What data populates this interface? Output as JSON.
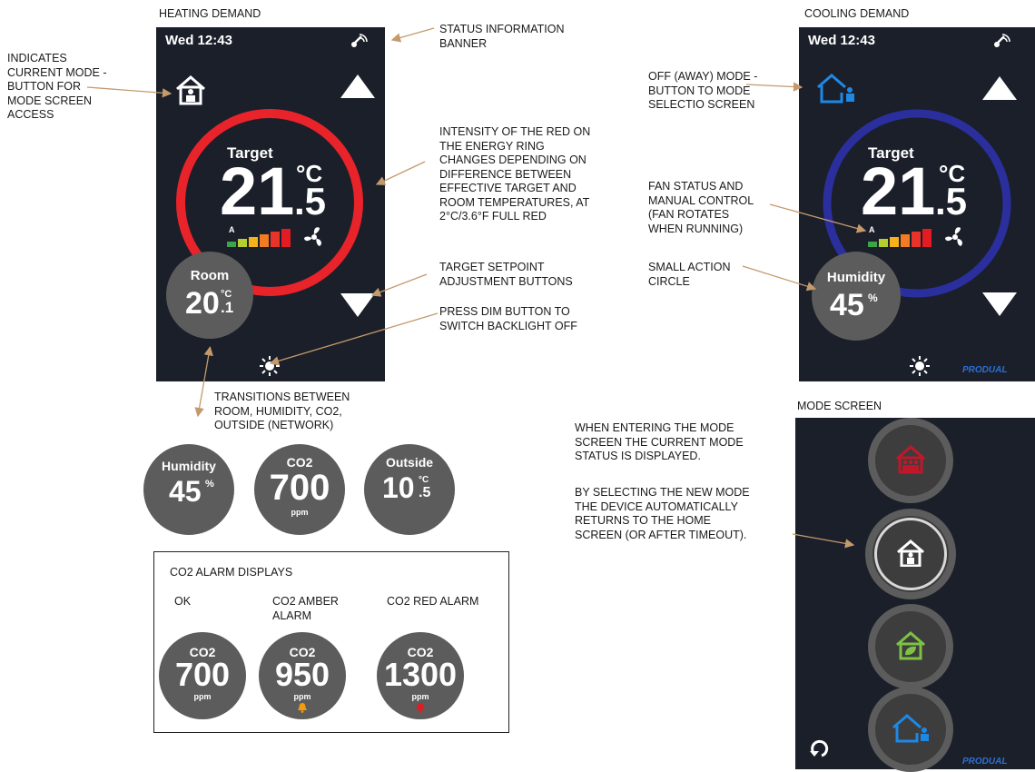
{
  "colors": {
    "screen_bg": "#1b1f2a",
    "heating_ring": "#e8232a",
    "cooling_ring": "#2b2f9e",
    "circle_gray": "#5c5c5c",
    "arrow": "#c49a6c",
    "brand_blue": "#2d6fd1",
    "mode_red": "#c0182a",
    "mode_green": "#7dc243",
    "mode_blue": "#1e88e5",
    "alarm_amber": "#f39c12",
    "alarm_red": "#e31b23"
  },
  "headings": {
    "heating": "HEATING DEMAND",
    "cooling": "COOLING DEMAND",
    "mode_screen": "MODE SCREEN"
  },
  "annotations": {
    "indicates_mode": "INDICATES\nCURRENT MODE -\nBUTTON FOR\nMODE SCREEN\nACCESS",
    "status_banner": "STATUS INFORMATION\nBANNER",
    "energy_ring": "INTENSITY OF THE RED ON\nTHE ENERGY RING\nCHANGES DEPENDING ON\nDIFFERENCE BETWEEN\nEFFECTIVE TARGET AND\nROOM TEMPERATURES, AT\n2°C/3.6°F FULL RED",
    "setpoint_buttons": "TARGET SETPOINT\nADJUSTMENT BUTTONS",
    "dim_button": "PRESS DIM BUTTON TO\nSWITCH BACKLIGHT OFF",
    "transitions": "TRANSITIONS BETWEEN\nROOM, HUMIDITY, CO2,\nOUTSIDE (NETWORK)",
    "away_mode": "OFF (AWAY) MODE -\nBUTTON TO MODE\nSELECTIO SCREEN",
    "fan_status": "FAN STATUS AND\nMANUAL CONTROL\n(FAN ROTATES\nWHEN RUNNING)",
    "small_action": "SMALL ACTION\nCIRCLE",
    "mode_enter": "WHEN ENTERING THE MODE\nSCREEN THE CURRENT MODE\nSTATUS IS DISPLAYED.",
    "mode_select": "BY SELECTING THE NEW MODE\nTHE DEVICE AUTOMATICALLY\nRETURNS TO THE HOME\nSCREEN (OR AFTER TIMEOUT)."
  },
  "heating_screen": {
    "time": "Wed 12:43",
    "target_label": "Target",
    "target_int": "21",
    "target_dec": ".5",
    "unit": "°C",
    "fan_auto": "A",
    "action_label": "Room",
    "action_int": "20",
    "action_unit": "°C",
    "action_dec": ".1",
    "icons": [
      "signal-icon",
      "home-mode-icon",
      "up-arrow-icon",
      "down-arrow-icon",
      "fan-icon",
      "dim-icon"
    ]
  },
  "cooling_screen": {
    "time": "Wed 12:43",
    "target_label": "Target",
    "target_int": "21",
    "target_dec": ".5",
    "unit": "°C",
    "fan_auto": "A",
    "action_label": "Humidity",
    "action_value": "45",
    "action_unit": "%",
    "brand": "PRODUAL",
    "icons": [
      "signal-icon",
      "away-mode-icon",
      "up-arrow-icon",
      "down-arrow-icon",
      "fan-icon",
      "dim-icon"
    ]
  },
  "transition_circles": [
    {
      "label": "Humidity",
      "value": "45",
      "unit": "%"
    },
    {
      "label": "CO2",
      "value": "700",
      "unit": "ppm"
    },
    {
      "label": "Outside",
      "value": "10",
      "unit": "°C",
      "dec": ".5"
    }
  ],
  "co2_alarm": {
    "title": "CO2 ALARM DISPLAYS",
    "columns": [
      {
        "caption": "OK",
        "label": "CO2",
        "value": "700",
        "unit": "ppm",
        "bell": "none"
      },
      {
        "caption": "CO2 AMBER\nALARM",
        "label": "CO2",
        "value": "950",
        "unit": "ppm",
        "bell": "amber"
      },
      {
        "caption": "CO2 RED ALARM",
        "label": "CO2",
        "value": "1300",
        "unit": "ppm",
        "bell": "red"
      }
    ]
  },
  "mode_screen": {
    "brand": "PRODUAL",
    "modes": [
      "occupied-party-mode",
      "home-mode",
      "eco-mode",
      "away-mode"
    ],
    "icons": [
      "back-icon"
    ]
  }
}
